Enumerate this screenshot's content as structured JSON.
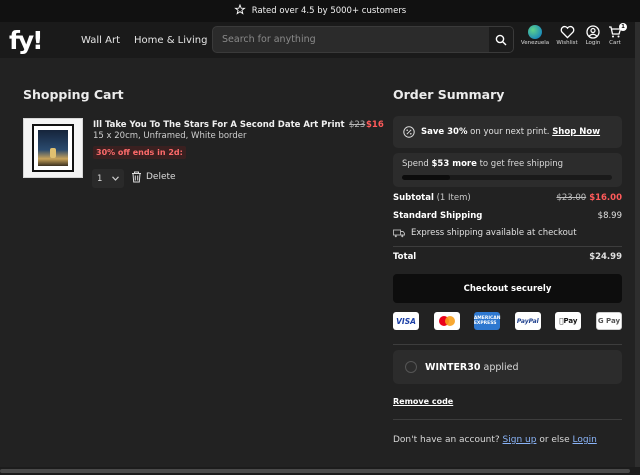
{
  "topbar": {
    "text": "Rated over 4.5 by 5000+ customers"
  },
  "header": {
    "logo": "fy!",
    "nav": [
      "Wall Art",
      "Home & Living"
    ],
    "search_placeholder": "Search for anything",
    "region_label": "Venezuela",
    "wishlist_label": "Wishlist",
    "login_label": "Login",
    "cart_label": "Cart",
    "cart_count": "1"
  },
  "cart": {
    "title": "Shopping Cart",
    "item": {
      "title": "Ill Take You To The Stars For A Second Date Art Print",
      "meta": "15 x 20cm, Unframed, White border",
      "promo": "30% off ends in 2d:",
      "price_old": "$23",
      "price_new": "$16",
      "quantity": "1",
      "delete_label": "Delete"
    }
  },
  "summary": {
    "title": "Order Summary",
    "promo_bold": "Save 30%",
    "promo_text": " on your next print. ",
    "promo_link": "Shop Now",
    "ship_prefix": "Spend ",
    "ship_amount": "$53 more",
    "ship_suffix": " to get free shipping",
    "ship_progress": 0.23,
    "subtotal_label": "Subtotal",
    "subtotal_count": " (1 Item)",
    "subtotal_old": "$23.00",
    "subtotal_new": "$16.00",
    "shipping_label": "Standard Shipping",
    "shipping_value": "$8.99",
    "express_note": "Express shipping available at checkout",
    "total_label": "Total",
    "total_value": "$24.99",
    "checkout_label": "Checkout securely",
    "payment_methods": [
      "VISA",
      "Mastercard",
      "American Express",
      "PayPal",
      "Pay",
      "G Pay"
    ],
    "coupon_code": "WINTER30",
    "coupon_suffix": " applied",
    "remove_code": "Remove code",
    "account_text": "Don't have an account? ",
    "signup_link": "Sign up",
    "or_text": " or else ",
    "login_link": "Login"
  }
}
